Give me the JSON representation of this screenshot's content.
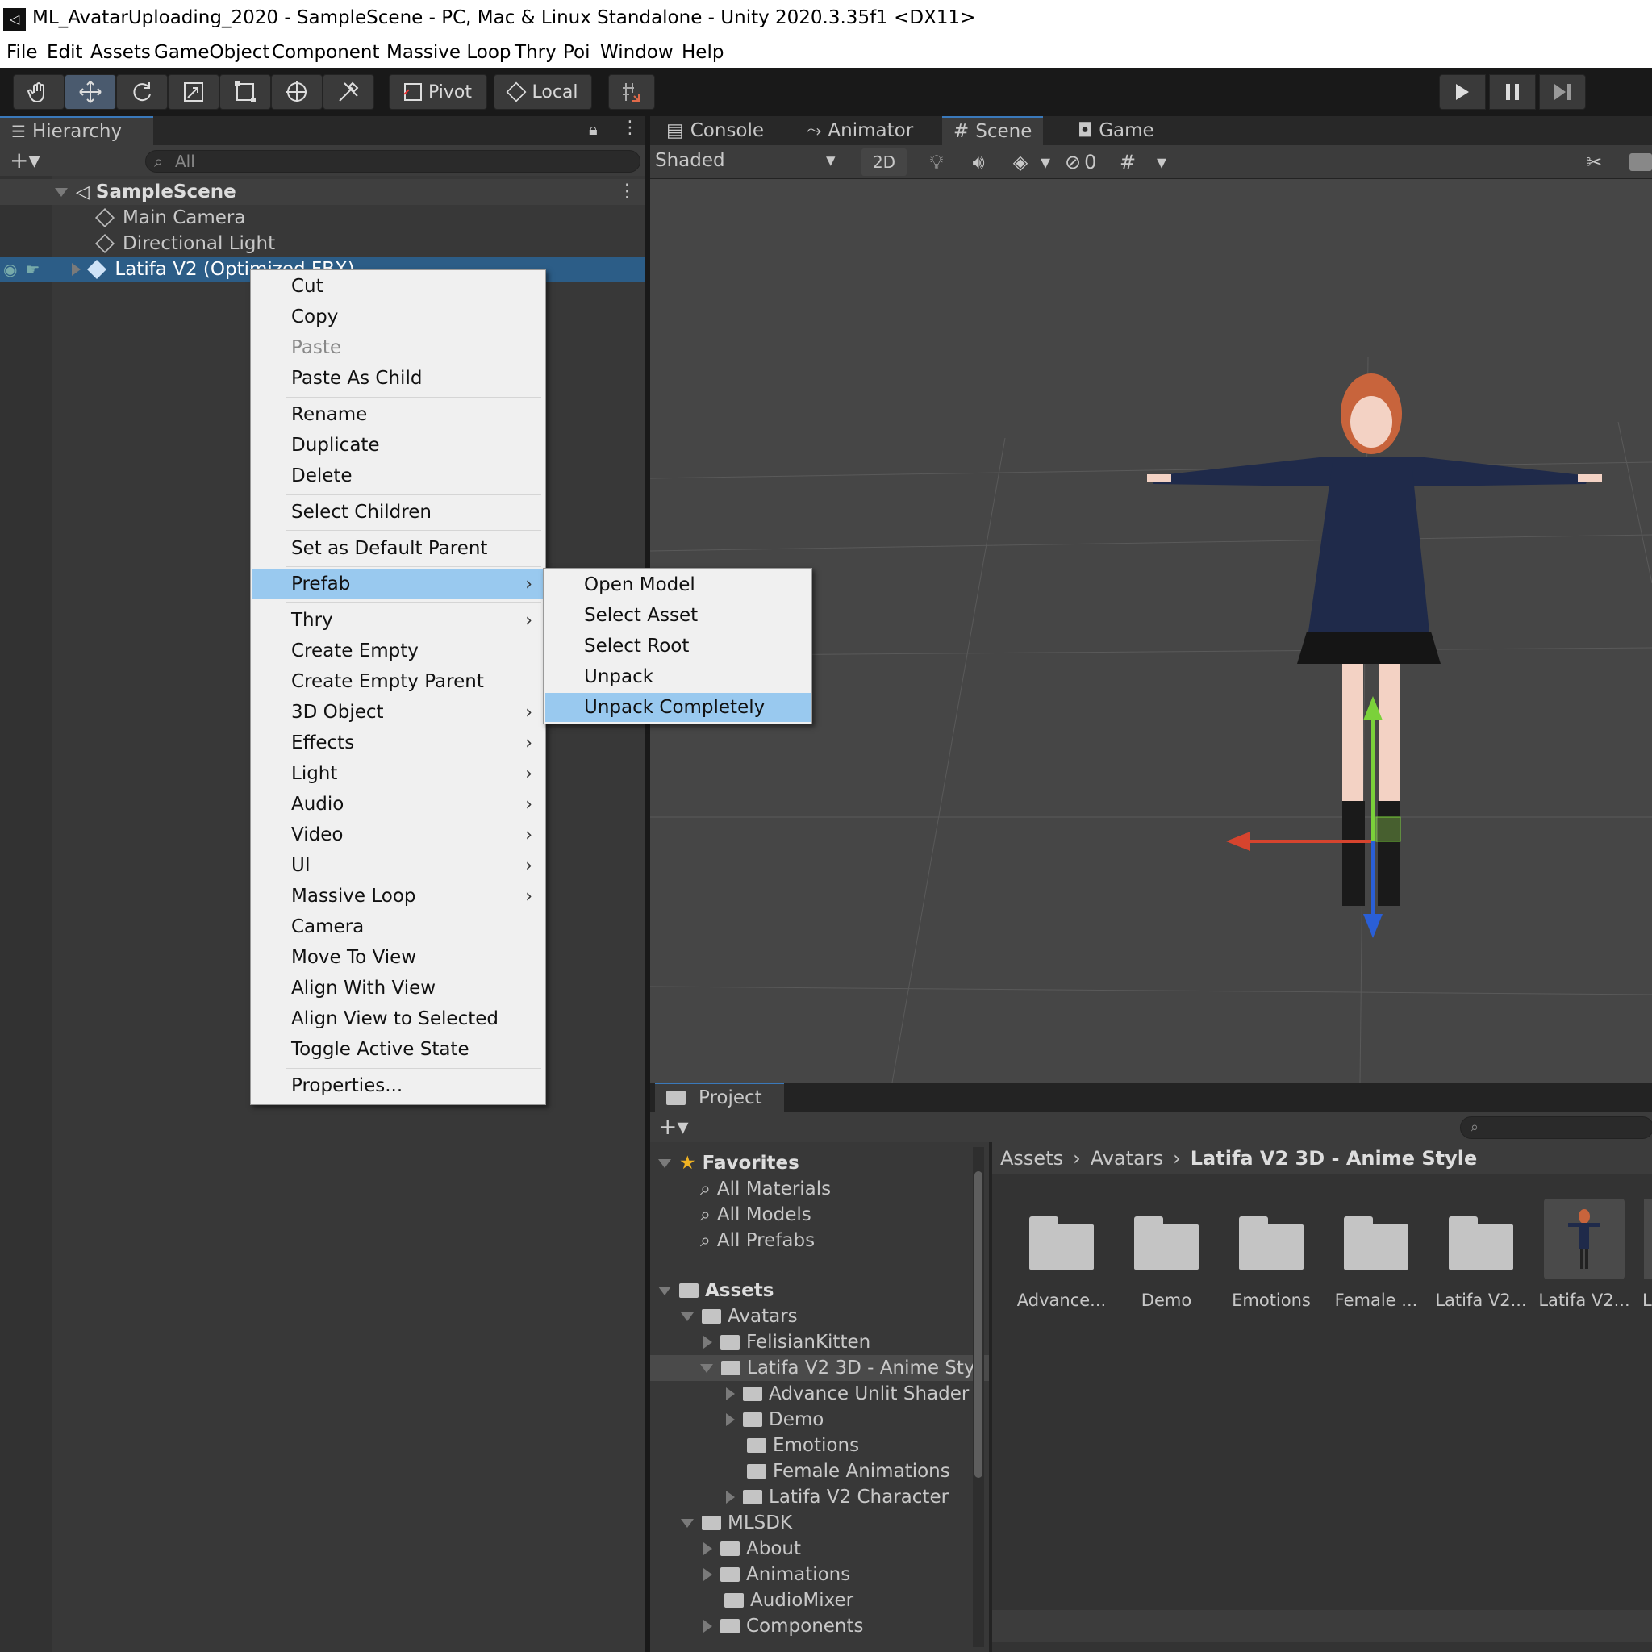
{
  "window": {
    "title": "ML_AvatarUploading_2020 - SampleScene - PC, Mac & Linux Standalone - Unity 2020.3.35f1 <DX11>"
  },
  "menubar": [
    "File",
    "Edit",
    "Assets",
    "GameObject",
    "Component",
    "Massive Loop",
    "Thry",
    "Poi",
    "Window",
    "Help"
  ],
  "toolbar": {
    "pivot": "Pivot",
    "local": "Local"
  },
  "hierarchy": {
    "tab": "Hierarchy",
    "search_placeholder": "All",
    "scene": "SampleScene",
    "items": [
      "Main Camera",
      "Directional Light",
      "Latifa V2 (Optimized FBX)"
    ]
  },
  "context_menu": {
    "items": [
      "Cut",
      "Copy",
      "Paste",
      "Paste As Child",
      "Rename",
      "Duplicate",
      "Delete",
      "Select Children",
      "Set as Default Parent",
      "Prefab",
      "Thry",
      "Create Empty",
      "Create Empty Parent",
      "3D Object",
      "Effects",
      "Light",
      "Audio",
      "Video",
      "UI",
      "Massive Loop",
      "Camera",
      "Move To View",
      "Align With View",
      "Align View to Selected",
      "Toggle Active State",
      "Properties..."
    ],
    "disabled": "Paste",
    "highlighted": "Prefab",
    "submenu_items": [
      "Thry",
      "3D Object",
      "Effects",
      "Light",
      "Audio",
      "Video",
      "UI",
      "Massive Loop",
      "Prefab"
    ]
  },
  "prefab_submenu": {
    "items": [
      "Open Model",
      "Select Asset",
      "Select Root",
      "Unpack",
      "Unpack Completely"
    ],
    "highlighted": "Unpack Completely"
  },
  "scene_tabs": [
    "Console",
    "Animator",
    "Scene",
    "Game"
  ],
  "scene_toolbar": {
    "shading": "Shaded",
    "mode_2d": "2D",
    "hidden_count": "0"
  },
  "project": {
    "tab": "Project",
    "favorites_label": "Favorites",
    "favorites": [
      "All Materials",
      "All Models",
      "All Prefabs"
    ],
    "assets_label": "Assets",
    "tree": [
      "Avatars",
      "FelisianKitten",
      "Latifa V2 3D - Anime Sty",
      "Advance Unlit Shader",
      "Demo",
      "Emotions",
      "Female Animations",
      "Latifa V2 Character",
      "MLSDK",
      "About",
      "Animations",
      "AudioMixer",
      "Components"
    ],
    "breadcrumb": [
      "Assets",
      "Avatars",
      "Latifa V2 3D - Anime Style"
    ],
    "grid": [
      "Advance...",
      "Demo",
      "Emotions",
      "Female ...",
      "Latifa V2...",
      "Latifa V2...",
      "L"
    ]
  },
  "colors": {
    "selection": "#2c5d87",
    "menu_highlight": "#99c9ef",
    "editor_bg": "#383838"
  }
}
